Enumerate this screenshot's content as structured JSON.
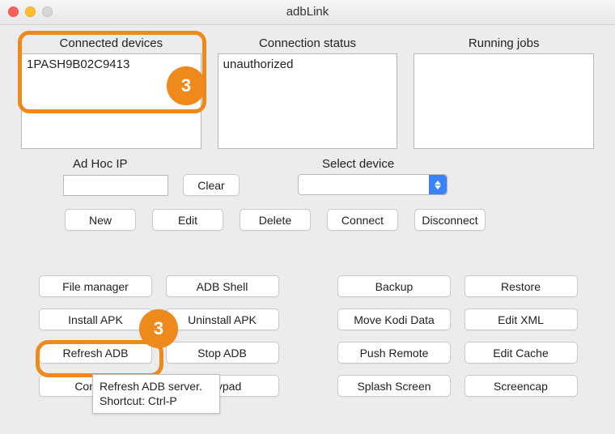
{
  "window": {
    "title": "adbLink"
  },
  "panels": {
    "connected": {
      "label": "Connected devices",
      "items": [
        "1PASH9B02C9413"
      ]
    },
    "status": {
      "label": "Connection status",
      "text": "unauthorized"
    },
    "jobs": {
      "label": "Running jobs",
      "text": ""
    }
  },
  "adhoc": {
    "label": "Ad Hoc IP",
    "value": "",
    "clear": "Clear"
  },
  "select": {
    "label": "Select device",
    "value": ""
  },
  "actions": {
    "new": "New",
    "edit": "Edit",
    "delete": "Delete",
    "connect": "Connect",
    "disconnect": "Disconnect"
  },
  "grid": {
    "r1": {
      "a": "File manager",
      "b": "ADB Shell",
      "c": "Backup",
      "d": "Restore"
    },
    "r2": {
      "a": "Install APK",
      "b": "Uninstall APK",
      "c": "Move Kodi Data",
      "d": "Edit XML"
    },
    "r3": {
      "a": "Refresh ADB",
      "b": "Stop ADB",
      "c": "Push Remote",
      "d": "Edit Cache"
    },
    "r4": {
      "a": "Console",
      "b": "Keypad",
      "c": "Splash Screen",
      "d": "Screencap"
    }
  },
  "tooltip": {
    "text": "Refresh ADB server. Shortcut: Ctrl-P"
  },
  "annotations": {
    "badge": "3"
  }
}
